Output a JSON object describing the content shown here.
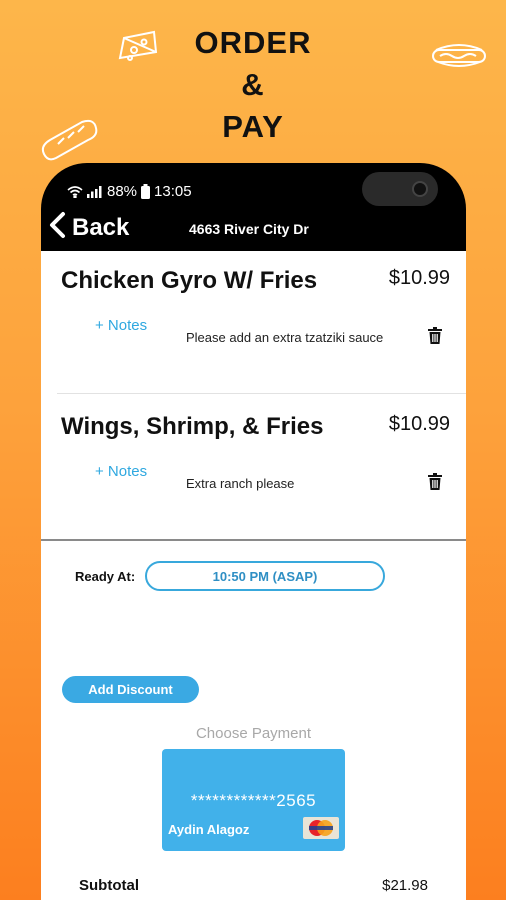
{
  "promo": {
    "line1": "ORDER",
    "line2": "&",
    "line3": "PAY"
  },
  "status_bar": {
    "battery": "88%",
    "time": "13:05"
  },
  "nav": {
    "back_label": "Back",
    "address": "4663 River City Dr"
  },
  "cart": {
    "items": [
      {
        "name": "Chicken Gyro W/ Fries",
        "price": "$10.99",
        "notes_label": "+ Notes",
        "note": "Please add an extra tzatziki sauce"
      },
      {
        "name": "Wings, Shrimp, & Fries",
        "price": "$10.99",
        "notes_label": "+ Notes",
        "note": "Extra ranch please"
      }
    ]
  },
  "ready": {
    "label": "Ready At:",
    "value": "10:50 PM (ASAP)"
  },
  "discount_label": "Add Discount",
  "payment": {
    "heading": "Choose Payment",
    "card_number": "************2565",
    "card_holder": "Aydin Alagoz",
    "card_brand": "MasterCard"
  },
  "summary": {
    "subtotal_label": "Subtotal",
    "subtotal_value": "$21.98"
  },
  "colors": {
    "accent_blue": "#3aa9e3",
    "background_top": "#fdb64a",
    "background_bottom": "#fc7f1f"
  }
}
